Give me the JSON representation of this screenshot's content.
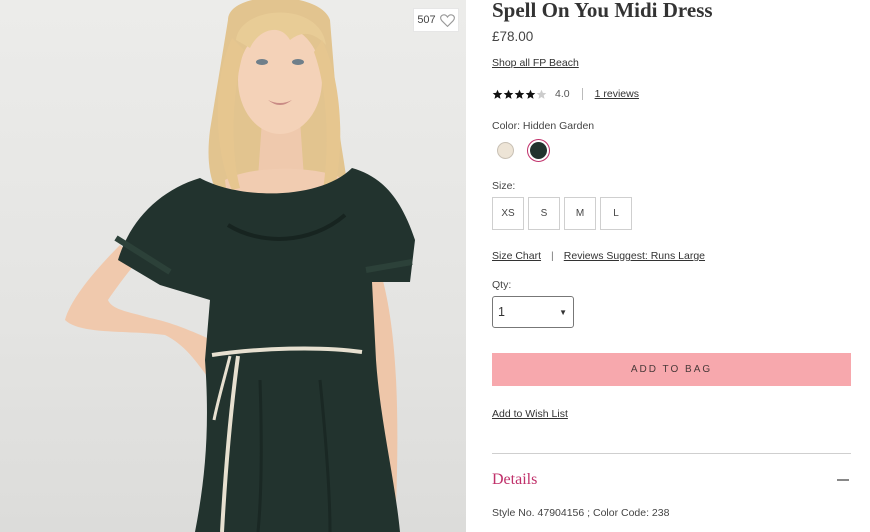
{
  "product": {
    "favorites_count": "507",
    "title": "Spell On You Midi Dress",
    "price": "£78.00",
    "shop_all_link": "Shop all FP Beach",
    "rating": {
      "stars": 4.0,
      "value_text": "4.0",
      "reviews_link": "1 reviews"
    },
    "color": {
      "label": "Color: Hidden Garden",
      "swatches": [
        {
          "name": "cream-swatch",
          "color": "#ede4d6",
          "selected": false
        },
        {
          "name": "hidden-garden-swatch",
          "color": "#22332e",
          "selected": true
        }
      ]
    },
    "size": {
      "label": "Size:",
      "options": [
        "XS",
        "S",
        "M",
        "L"
      ]
    },
    "size_chart_link": "Size Chart",
    "fit_note_link": "Reviews Suggest: Runs Large",
    "quantity": {
      "label": "Qty:",
      "value": "1"
    },
    "add_to_bag": "ADD TO BAG",
    "wishlist_link": "Add to Wish List",
    "details": {
      "title": "Details",
      "style_line": "Style No. 47904156 ; Color Code: 238"
    }
  },
  "colors": {
    "accent": "#c0306a",
    "button_bg": "#f7a8ad",
    "dress": "#22332e"
  },
  "icons": {
    "favorite": "heart-outline-icon",
    "collapse": "minus-icon",
    "dropdown": "triangle-down-icon",
    "star": "star-icon"
  }
}
